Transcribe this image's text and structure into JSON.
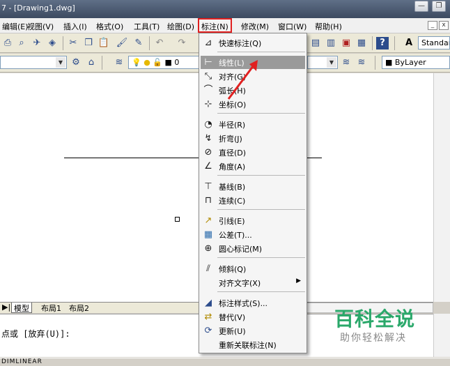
{
  "window": {
    "title": "7 - [Drawing1.dwg]",
    "min_glyph": "—",
    "restore_glyph": "❐"
  },
  "menubar": {
    "items": [
      {
        "label": "编辑(E)"
      },
      {
        "label": "视图(V)"
      },
      {
        "label": "插入(I)"
      },
      {
        "label": "格式(O)"
      },
      {
        "label": "工具(T)"
      },
      {
        "label": "绘图(D)"
      },
      {
        "label": "标注(N)"
      },
      {
        "label": "修改(M)"
      },
      {
        "label": "窗口(W)"
      },
      {
        "label": "帮助(H)"
      }
    ],
    "doc_min": "_",
    "doc_close": "x"
  },
  "toolbar1": {
    "text_style": "Standar"
  },
  "toolbar2": {
    "layer_value": "0",
    "linetype_value": "ByLayer"
  },
  "dimension_menu": {
    "items": [
      {
        "label": "快速标注(Q)",
        "icon": "quick-dimension-icon",
        "glyph": "⊿"
      },
      {
        "label": "线性(L)",
        "icon": "linear-dimension-icon",
        "glyph": "⊢",
        "highlighted": true
      },
      {
        "label": "对齐(G)",
        "icon": "aligned-dimension-icon",
        "glyph": "⤡"
      },
      {
        "label": "弧长(H)",
        "icon": "arc-length-icon",
        "glyph": "⌒"
      },
      {
        "label": "坐标(O)",
        "icon": "ordinate-icon",
        "glyph": "⊹"
      },
      {
        "label": "半径(R)",
        "icon": "radius-icon",
        "glyph": "◔"
      },
      {
        "label": "折弯(J)",
        "icon": "jogged-icon",
        "glyph": "↯"
      },
      {
        "label": "直径(D)",
        "icon": "diameter-icon",
        "glyph": "⊘"
      },
      {
        "label": "角度(A)",
        "icon": "angular-icon",
        "glyph": "∠"
      },
      {
        "label": "基线(B)",
        "icon": "baseline-icon",
        "glyph": "⊤"
      },
      {
        "label": "连续(C)",
        "icon": "continue-icon",
        "glyph": "⊓"
      },
      {
        "label": "引线(E)",
        "icon": "leader-icon",
        "glyph": "↗"
      },
      {
        "label": "公差(T)...",
        "icon": "tolerance-icon",
        "glyph": "▦"
      },
      {
        "label": "圆心标记(M)",
        "icon": "center-mark-icon",
        "glyph": "⊕"
      },
      {
        "label": "倾斜(Q)",
        "icon": "oblique-icon",
        "glyph": "⫽"
      },
      {
        "label": "对齐文字(X)",
        "icon": "",
        "glyph": "",
        "submenu": true
      },
      {
        "label": "标注样式(S)...",
        "icon": "dim-style-icon",
        "glyph": "◢"
      },
      {
        "label": "替代(V)",
        "icon": "override-icon",
        "glyph": "⇄"
      },
      {
        "label": "更新(U)",
        "icon": "update-icon",
        "glyph": "⟳"
      },
      {
        "label": "重新关联标注(N)",
        "icon": "",
        "glyph": ""
      }
    ],
    "submenu_glyph": "▶"
  },
  "layout_tabs": [
    {
      "label": "模型"
    },
    {
      "label": "布局1"
    },
    {
      "label": "布局2"
    }
  ],
  "tab_nav_glyph": "▶|",
  "command": {
    "prompt": "点或 [放弃(U)]:"
  },
  "status": {
    "text": "DIMLINEAR"
  },
  "watermark": {
    "title": "百科全说",
    "subtitle": "助你轻松解决"
  }
}
